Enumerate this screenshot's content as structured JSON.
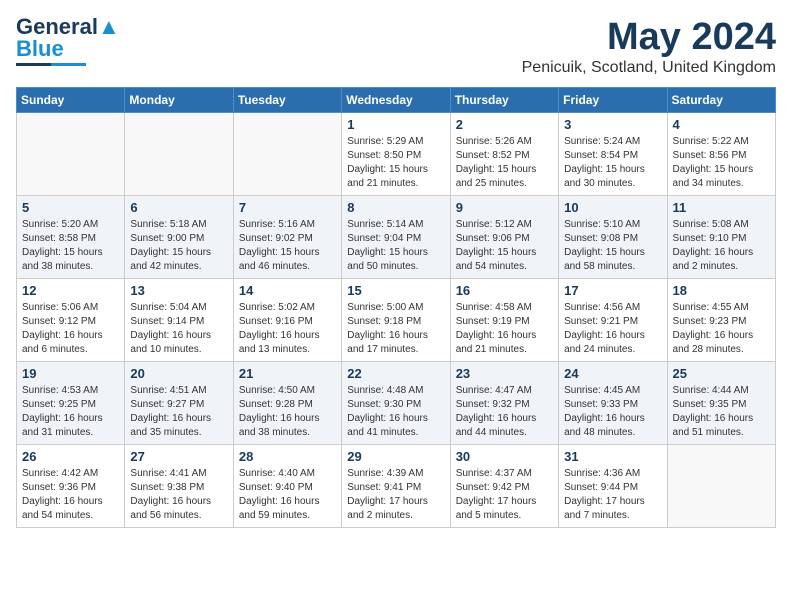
{
  "header": {
    "logo_general": "General",
    "logo_blue": "Blue",
    "main_title": "May 2024",
    "subtitle": "Penicuik, Scotland, United Kingdom"
  },
  "days_of_week": [
    "Sunday",
    "Monday",
    "Tuesday",
    "Wednesday",
    "Thursday",
    "Friday",
    "Saturday"
  ],
  "weeks": [
    [
      {
        "day": "",
        "info": ""
      },
      {
        "day": "",
        "info": ""
      },
      {
        "day": "",
        "info": ""
      },
      {
        "day": "1",
        "info": "Sunrise: 5:29 AM\nSunset: 8:50 PM\nDaylight: 15 hours and 21 minutes."
      },
      {
        "day": "2",
        "info": "Sunrise: 5:26 AM\nSunset: 8:52 PM\nDaylight: 15 hours and 25 minutes."
      },
      {
        "day": "3",
        "info": "Sunrise: 5:24 AM\nSunset: 8:54 PM\nDaylight: 15 hours and 30 minutes."
      },
      {
        "day": "4",
        "info": "Sunrise: 5:22 AM\nSunset: 8:56 PM\nDaylight: 15 hours and 34 minutes."
      }
    ],
    [
      {
        "day": "5",
        "info": "Sunrise: 5:20 AM\nSunset: 8:58 PM\nDaylight: 15 hours and 38 minutes."
      },
      {
        "day": "6",
        "info": "Sunrise: 5:18 AM\nSunset: 9:00 PM\nDaylight: 15 hours and 42 minutes."
      },
      {
        "day": "7",
        "info": "Sunrise: 5:16 AM\nSunset: 9:02 PM\nDaylight: 15 hours and 46 minutes."
      },
      {
        "day": "8",
        "info": "Sunrise: 5:14 AM\nSunset: 9:04 PM\nDaylight: 15 hours and 50 minutes."
      },
      {
        "day": "9",
        "info": "Sunrise: 5:12 AM\nSunset: 9:06 PM\nDaylight: 15 hours and 54 minutes."
      },
      {
        "day": "10",
        "info": "Sunrise: 5:10 AM\nSunset: 9:08 PM\nDaylight: 15 hours and 58 minutes."
      },
      {
        "day": "11",
        "info": "Sunrise: 5:08 AM\nSunset: 9:10 PM\nDaylight: 16 hours and 2 minutes."
      }
    ],
    [
      {
        "day": "12",
        "info": "Sunrise: 5:06 AM\nSunset: 9:12 PM\nDaylight: 16 hours and 6 minutes."
      },
      {
        "day": "13",
        "info": "Sunrise: 5:04 AM\nSunset: 9:14 PM\nDaylight: 16 hours and 10 minutes."
      },
      {
        "day": "14",
        "info": "Sunrise: 5:02 AM\nSunset: 9:16 PM\nDaylight: 16 hours and 13 minutes."
      },
      {
        "day": "15",
        "info": "Sunrise: 5:00 AM\nSunset: 9:18 PM\nDaylight: 16 hours and 17 minutes."
      },
      {
        "day": "16",
        "info": "Sunrise: 4:58 AM\nSunset: 9:19 PM\nDaylight: 16 hours and 21 minutes."
      },
      {
        "day": "17",
        "info": "Sunrise: 4:56 AM\nSunset: 9:21 PM\nDaylight: 16 hours and 24 minutes."
      },
      {
        "day": "18",
        "info": "Sunrise: 4:55 AM\nSunset: 9:23 PM\nDaylight: 16 hours and 28 minutes."
      }
    ],
    [
      {
        "day": "19",
        "info": "Sunrise: 4:53 AM\nSunset: 9:25 PM\nDaylight: 16 hours and 31 minutes."
      },
      {
        "day": "20",
        "info": "Sunrise: 4:51 AM\nSunset: 9:27 PM\nDaylight: 16 hours and 35 minutes."
      },
      {
        "day": "21",
        "info": "Sunrise: 4:50 AM\nSunset: 9:28 PM\nDaylight: 16 hours and 38 minutes."
      },
      {
        "day": "22",
        "info": "Sunrise: 4:48 AM\nSunset: 9:30 PM\nDaylight: 16 hours and 41 minutes."
      },
      {
        "day": "23",
        "info": "Sunrise: 4:47 AM\nSunset: 9:32 PM\nDaylight: 16 hours and 44 minutes."
      },
      {
        "day": "24",
        "info": "Sunrise: 4:45 AM\nSunset: 9:33 PM\nDaylight: 16 hours and 48 minutes."
      },
      {
        "day": "25",
        "info": "Sunrise: 4:44 AM\nSunset: 9:35 PM\nDaylight: 16 hours and 51 minutes."
      }
    ],
    [
      {
        "day": "26",
        "info": "Sunrise: 4:42 AM\nSunset: 9:36 PM\nDaylight: 16 hours and 54 minutes."
      },
      {
        "day": "27",
        "info": "Sunrise: 4:41 AM\nSunset: 9:38 PM\nDaylight: 16 hours and 56 minutes."
      },
      {
        "day": "28",
        "info": "Sunrise: 4:40 AM\nSunset: 9:40 PM\nDaylight: 16 hours and 59 minutes."
      },
      {
        "day": "29",
        "info": "Sunrise: 4:39 AM\nSunset: 9:41 PM\nDaylight: 17 hours and 2 minutes."
      },
      {
        "day": "30",
        "info": "Sunrise: 4:37 AM\nSunset: 9:42 PM\nDaylight: 17 hours and 5 minutes."
      },
      {
        "day": "31",
        "info": "Sunrise: 4:36 AM\nSunset: 9:44 PM\nDaylight: 17 hours and 7 minutes."
      },
      {
        "day": "",
        "info": ""
      }
    ]
  ]
}
